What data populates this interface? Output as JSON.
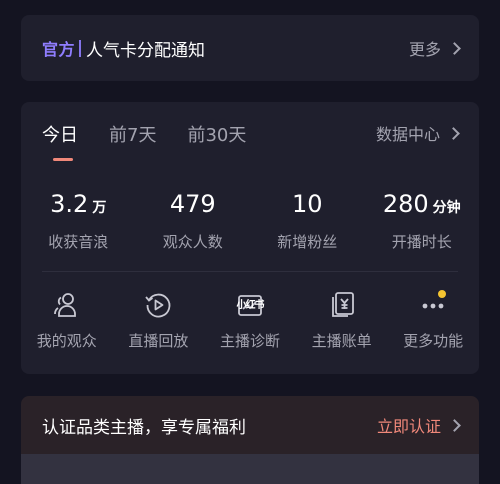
{
  "notice": {
    "brand": "官方",
    "title": "人气卡分配通知",
    "more": "更多"
  },
  "stats": {
    "tabs": [
      "今日",
      "前7天",
      "前30天"
    ],
    "active_tab": "今日",
    "data_center": "数据中心",
    "metrics": [
      {
        "value": "3.2",
        "unit": "万",
        "label": "收获音浪"
      },
      {
        "value": "479",
        "unit": "",
        "label": "观众人数"
      },
      {
        "value": "10",
        "unit": "",
        "label": "新增粉丝"
      },
      {
        "value": "280",
        "unit": "分钟",
        "label": "开播时长"
      }
    ]
  },
  "functions": [
    {
      "label": "我的观众",
      "icon": "audience-icon"
    },
    {
      "label": "直播回放",
      "icon": "replay-icon"
    },
    {
      "label": "主播诊断",
      "icon": "diagnosis-icon",
      "watermark": "小红书"
    },
    {
      "label": "主播账单",
      "icon": "bill-icon"
    },
    {
      "label": "更多功能",
      "icon": "more-icon",
      "badge": true
    }
  ],
  "certification": {
    "title": "认证品类主播，享专属福利",
    "action": "立即认证"
  },
  "colors": {
    "background": "#141421",
    "card": "#1f1f2d",
    "brand": "#8f7dff",
    "accent": "#f0887a",
    "badge": "#f4c431",
    "muted": "#a3a3af"
  }
}
